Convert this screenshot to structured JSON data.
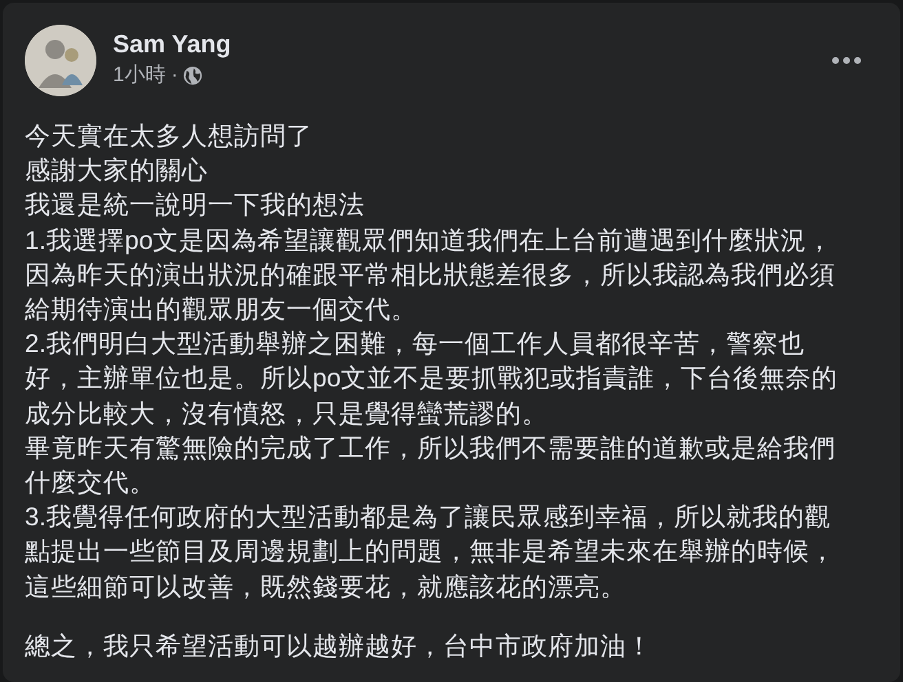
{
  "post": {
    "author": "Sam Yang",
    "time": "1小時",
    "separator": "·",
    "blocks": [
      {
        "lines": [
          "今天實在太多人想訪問了",
          "感謝大家的關心",
          "我還是統一說明一下我的想法",
          "1.我選擇po文是因為希望讓觀眾們知道我們在上台前遭遇到什麼狀況，",
          "因為昨天的演出狀況的確跟平常相比狀態差很多，所以我認為我們必須",
          "給期待演出的觀眾朋友一個交代。",
          "2.我們明白大型活動舉辦之困難，每一個工作人員都很辛苦，警察也",
          "好，主辦單位也是。所以po文並不是要抓戰犯或指責誰，下台後無奈的",
          "成分比較大，沒有憤怒，只是覺得蠻荒謬的。",
          "畢竟昨天有驚無險的完成了工作，所以我們不需要誰的道歉或是給我們",
          "什麼交代。",
          "3.我覺得任何政府的大型活動都是為了讓民眾感到幸福，所以就我的觀",
          "點提出一些節目及周邊規劃上的問題，無非是希望未來在舉辦的時候，",
          "這些細節可以改善，既然錢要花，就應該花的漂亮。"
        ]
      },
      {
        "lines": [
          "總之，我只希望活動可以越辦越好，台中市政府加油！"
        ]
      }
    ]
  }
}
